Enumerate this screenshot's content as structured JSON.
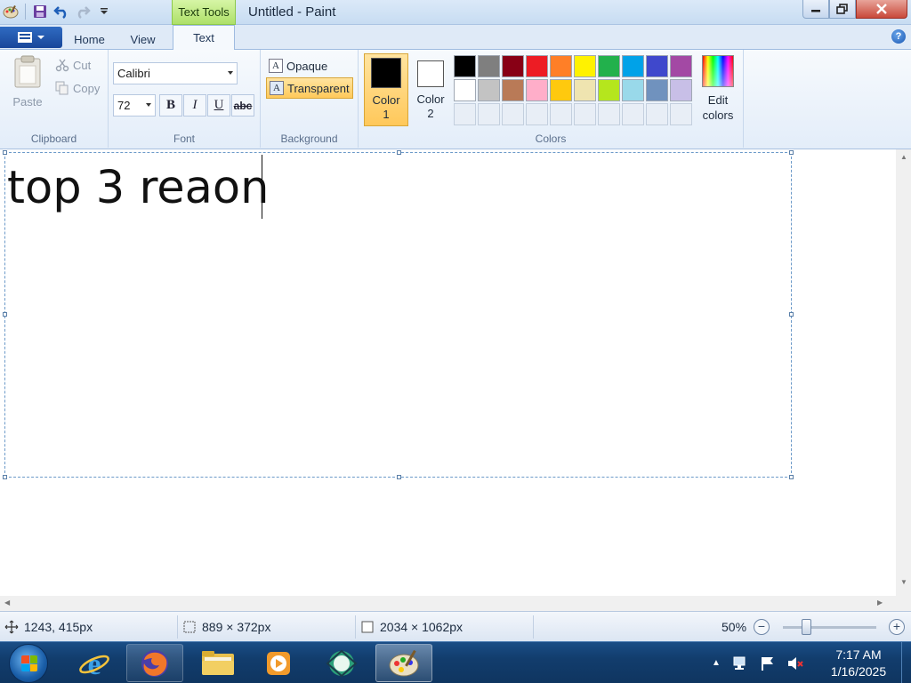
{
  "window": {
    "title": "Untitled - Paint",
    "contextual_tab": "Text Tools"
  },
  "ribbon_tabs": [
    {
      "label": "Home",
      "active": false
    },
    {
      "label": "View",
      "active": false
    },
    {
      "label": "Text",
      "active": true
    }
  ],
  "clipboard": {
    "paste": "Paste",
    "cut": "Cut",
    "copy": "Copy",
    "group": "Clipboard"
  },
  "font": {
    "family": "Calibri",
    "size": "72",
    "group": "Font",
    "bold": "B",
    "italic": "I",
    "underline": "U",
    "strikethrough": "abc"
  },
  "background": {
    "opaque": "Opaque",
    "transparent": "Transparent",
    "selected": "transparent",
    "group": "Background"
  },
  "colors": {
    "group": "Colors",
    "color1": {
      "line1": "Color",
      "line2": "1",
      "value": "#000000"
    },
    "color2": {
      "line1": "Color",
      "line2": "2",
      "value": "#ffffff"
    },
    "edit_line1": "Edit",
    "edit_line2": "colors",
    "palette": [
      "#000000",
      "#7f7f7f",
      "#880015",
      "#ed1c24",
      "#ff7f27",
      "#fff200",
      "#22b14c",
      "#00a2e8",
      "#3f48cc",
      "#a349a4",
      "#ffffff",
      "#c3c3c3",
      "#b97a57",
      "#ffaec9",
      "#ffc90e",
      "#efe4b0",
      "#b5e61d",
      "#99d9ea",
      "#7092be",
      "#c8bfe7",
      "",
      "",
      "",
      "",
      "",
      "",
      "",
      "",
      "",
      ""
    ]
  },
  "canvas": {
    "text": "top 3 reaon"
  },
  "status": {
    "cursor": "1243, 415px",
    "selection": "889 × 372px",
    "image_size": "2034 × 1062px",
    "zoom": "50%",
    "zoom_fraction": 0.5
  },
  "taskbar": {
    "apps": [
      "internet-explorer-icon",
      "firefox-icon",
      "file-explorer-icon",
      "media-player-icon",
      "network-app-icon",
      "paint-icon"
    ],
    "time": "7:17 AM",
    "date": "1/16/2025"
  }
}
